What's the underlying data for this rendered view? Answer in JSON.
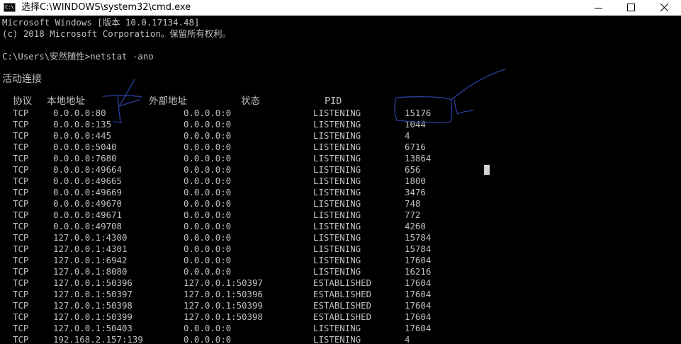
{
  "window": {
    "title": "选择C:\\WINDOWS\\system32\\cmd.exe",
    "icon": "cmd-icon",
    "icon_text": "C:\\"
  },
  "console": {
    "version_line": "Microsoft Windows [版本 10.0.17134.48]",
    "copyright_line": "(c) 2018 Microsoft Corporation。保留所有权利。",
    "prompt_line": "C:\\Users\\安然随性>netstat -ano",
    "section_title": "活动连接",
    "headers": {
      "proto": "协议",
      "local": "本地地址",
      "foreign": "外部地址",
      "state": "状态",
      "pid": "PID"
    },
    "rows": [
      {
        "proto": "TCP",
        "local": "0.0.0.0:80",
        "foreign": "0.0.0.0:0",
        "state": "LISTENING",
        "pid": "15176"
      },
      {
        "proto": "TCP",
        "local": "0.0.0.0:135",
        "foreign": "0.0.0.0:0",
        "state": "LISTENING",
        "pid": "1044"
      },
      {
        "proto": "TCP",
        "local": "0.0.0.0:445",
        "foreign": "0.0.0.0:0",
        "state": "LISTENING",
        "pid": "4"
      },
      {
        "proto": "TCP",
        "local": "0.0.0.0:5040",
        "foreign": "0.0.0.0:0",
        "state": "LISTENING",
        "pid": "6716"
      },
      {
        "proto": "TCP",
        "local": "0.0.0.0:7680",
        "foreign": "0.0.0.0:0",
        "state": "LISTENING",
        "pid": "13864"
      },
      {
        "proto": "TCP",
        "local": "0.0.0.0:49664",
        "foreign": "0.0.0.0:0",
        "state": "LISTENING",
        "pid": "656"
      },
      {
        "proto": "TCP",
        "local": "0.0.0.0:49665",
        "foreign": "0.0.0.0:0",
        "state": "LISTENING",
        "pid": "1800"
      },
      {
        "proto": "TCP",
        "local": "0.0.0.0:49669",
        "foreign": "0.0.0.0:0",
        "state": "LISTENING",
        "pid": "3476"
      },
      {
        "proto": "TCP",
        "local": "0.0.0.0:49670",
        "foreign": "0.0.0.0:0",
        "state": "LISTENING",
        "pid": "748"
      },
      {
        "proto": "TCP",
        "local": "0.0.0.0:49671",
        "foreign": "0.0.0.0:0",
        "state": "LISTENING",
        "pid": "772"
      },
      {
        "proto": "TCP",
        "local": "0.0.0.0:49708",
        "foreign": "0.0.0.0:0",
        "state": "LISTENING",
        "pid": "4260"
      },
      {
        "proto": "TCP",
        "local": "127.0.0.1:4300",
        "foreign": "0.0.0.0:0",
        "state": "LISTENING",
        "pid": "15784"
      },
      {
        "proto": "TCP",
        "local": "127.0.0.1:4301",
        "foreign": "0.0.0.0:0",
        "state": "LISTENING",
        "pid": "15784"
      },
      {
        "proto": "TCP",
        "local": "127.0.0.1:6942",
        "foreign": "0.0.0.0:0",
        "state": "LISTENING",
        "pid": "17604"
      },
      {
        "proto": "TCP",
        "local": "127.0.0.1:8080",
        "foreign": "0.0.0.0:0",
        "state": "LISTENING",
        "pid": "16216"
      },
      {
        "proto": "TCP",
        "local": "127.0.0.1:50396",
        "foreign": "127.0.0.1:50397",
        "state": "ESTABLISHED",
        "pid": "17604"
      },
      {
        "proto": "TCP",
        "local": "127.0.0.1:50397",
        "foreign": "127.0.0.1:50396",
        "state": "ESTABLISHED",
        "pid": "17604"
      },
      {
        "proto": "TCP",
        "local": "127.0.0.1:50398",
        "foreign": "127.0.0.1:50399",
        "state": "ESTABLISHED",
        "pid": "17604"
      },
      {
        "proto": "TCP",
        "local": "127.0.0.1:50399",
        "foreign": "127.0.0.1:50398",
        "state": "ESTABLISHED",
        "pid": "17604"
      },
      {
        "proto": "TCP",
        "local": "127.0.0.1:50403",
        "foreign": "0.0.0.0:0",
        "state": "LISTENING",
        "pid": "17604"
      },
      {
        "proto": "TCP",
        "local": "192.168.2.157:139",
        "foreign": "0.0.0.0:0",
        "state": "LISTENING",
        "pid": "4"
      }
    ]
  },
  "colors": {
    "console_bg": "#000000",
    "console_text": "#c0c0c0",
    "annotation_ink": "#2b3f9e",
    "titlebar_bg": "#ffffff"
  }
}
